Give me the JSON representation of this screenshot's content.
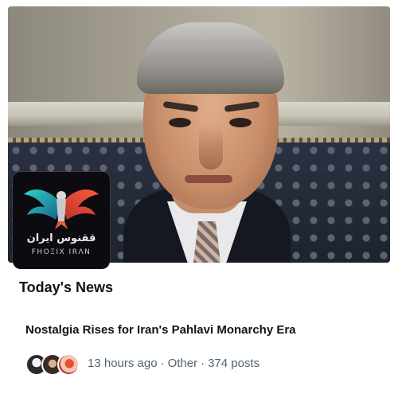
{
  "hero": {
    "alt": "",
    "logo": {
      "arabic_text": "ققنوس ایران",
      "latin_text": "FHOΞIX IRΛN"
    }
  },
  "section": {
    "title": "Today's News"
  },
  "story": {
    "headline": "Nostalgia Rises for Iran's Pahlavi Monarchy Era",
    "time": "13 hours ago",
    "category": "Other",
    "posts": "374 posts",
    "separator": "·"
  },
  "icons": {
    "logo": "phoenix-icon"
  },
  "colors": {
    "text_primary": "#0f1419",
    "text_secondary": "#536471",
    "background": "#ffffff"
  }
}
